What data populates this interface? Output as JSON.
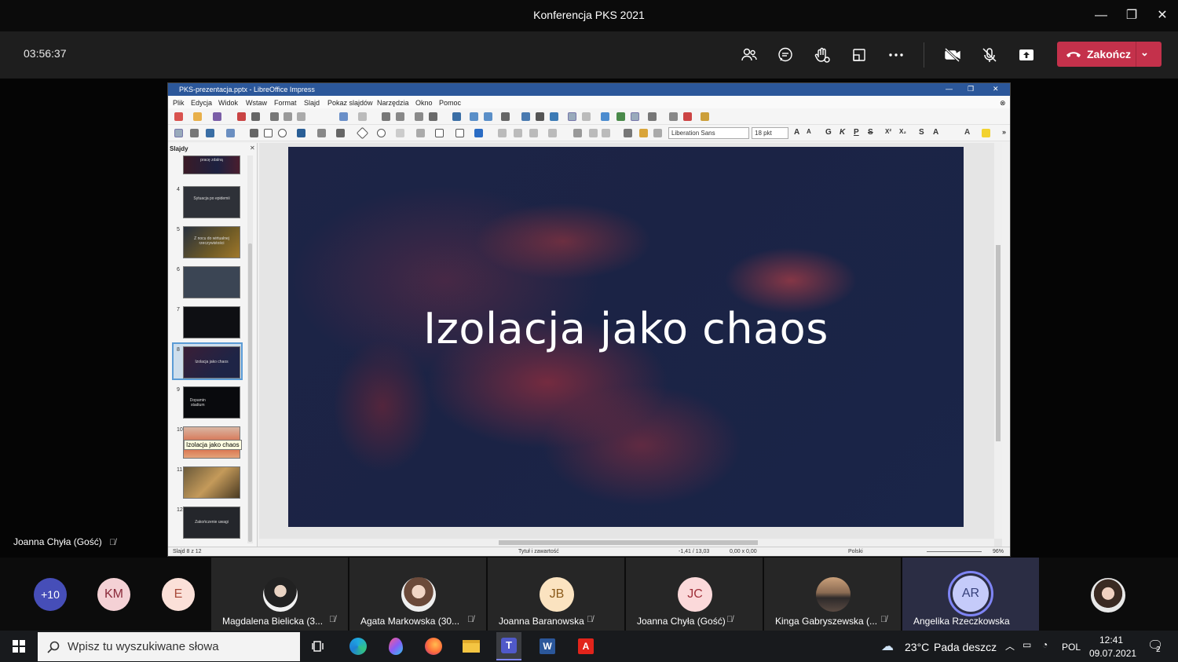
{
  "window": {
    "title": "Konferencja PKS 2021"
  },
  "meeting": {
    "timer": "03:56:37",
    "end_call_label": "Zakończ",
    "presenter_label": "Joanna Chyła (Gość)"
  },
  "libreoffice": {
    "title": "PKS-prezentacja.pptx - LibreOffice Impress",
    "menu": [
      "Plik",
      "Edycja",
      "Widok",
      "Wstaw",
      "Format",
      "Slajd",
      "Pokaz slajdów",
      "Narzędzia",
      "Okno",
      "Pomoc"
    ],
    "font_name": "Liberation Sans",
    "font_size": "18 pkt",
    "format_buttons": [
      "G",
      "K",
      "P",
      "S"
    ],
    "slides_panel_title": "Slajdy",
    "thumbnails": [
      {
        "num": "",
        "text": "pracę zdalną"
      },
      {
        "num": "4",
        "text": "Sytuacja po epidemii"
      },
      {
        "num": "5",
        "text": "Z nocu do wirtualnej rzeczywistości"
      },
      {
        "num": "6",
        "text": ""
      },
      {
        "num": "7",
        "text": ""
      },
      {
        "num": "8",
        "text": "Izolacja jako chaos"
      },
      {
        "num": "9",
        "text": "Dopamin stadium"
      },
      {
        "num": "10",
        "text": ""
      },
      {
        "num": "11",
        "text": ""
      },
      {
        "num": "12",
        "text": "Zakończenie uwagi"
      }
    ],
    "tooltip": "Izolacja jako chaos",
    "slide_title": "Izolacja jako chaos",
    "status": {
      "slide": "Slajd 8 z 12",
      "layout": "Tytuł i zawartość",
      "position": "-1,41 / 13,03",
      "size": "0,00 x 0,00",
      "language": "Polski",
      "zoom": "96%"
    }
  },
  "participants": {
    "overflow": "+10",
    "initials": [
      "KM",
      "E"
    ],
    "tiles": [
      {
        "name": "Magdalena Bielicka (3...",
        "type": "photo"
      },
      {
        "name": "Agata Markowska (30...",
        "type": "photo"
      },
      {
        "name": "Joanna Baranowska",
        "initials": "JB"
      },
      {
        "name": "Joanna Chyła (Gość)",
        "initials": "JC"
      },
      {
        "name": "Kinga Gabryszewska (...",
        "type": "photo"
      },
      {
        "name": "Angelika Rzeczkowska",
        "initials": "AR"
      }
    ]
  },
  "taskbar": {
    "search_placeholder": "Wpisz tu wyszukiwane słowa",
    "weather_temp": "23°C",
    "weather_desc": "Pada deszcz",
    "language": "POL",
    "time": "12:41",
    "date": "09.07.2021",
    "notifications": "2"
  },
  "colors": {
    "end_call": "#c4314b",
    "teams_bar": "#1e1e1e",
    "lo_title": "#2b579a"
  }
}
